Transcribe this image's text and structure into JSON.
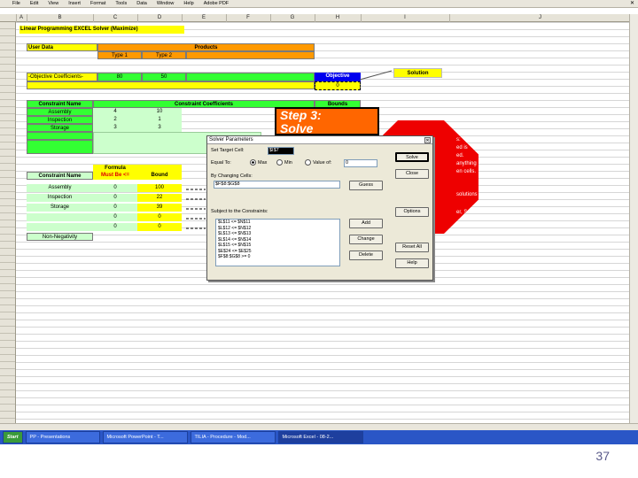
{
  "app": {
    "menu": [
      "File",
      "Edit",
      "View",
      "Insert",
      "Format",
      "Tools",
      "Data",
      "Window",
      "Help",
      "Adobe PDF"
    ],
    "columns": [
      "A",
      "B",
      "C",
      "D",
      "E",
      "F",
      "G",
      "H",
      "I",
      "J"
    ]
  },
  "sheet": {
    "title": "Linear Programming EXCEL Solver (Maximize)",
    "user_data": "User Data",
    "products": "Products",
    "type1": "Type 1",
    "type2": "Type 2",
    "objective_coefficients": "-Objective Coefficients-",
    "coef1": "80",
    "coef2": "50",
    "objective": "Objective",
    "objective_value": "0",
    "solution_label": "Solution",
    "constraint_name_header": "Constraint Name",
    "constraint_coefficients_header": "Constraint Coefficients",
    "bounds_header": "Bounds",
    "constraints": [
      {
        "name": "Assembly",
        "c1": "4",
        "c2": "10"
      },
      {
        "name": "Inspection",
        "c1": "2",
        "c2": "1"
      },
      {
        "name": "Storage",
        "c1": "3",
        "c2": "3"
      }
    ],
    "formula_header_1": "Formula",
    "formula_header_2": "Must Be <=",
    "bound_header": "Bound",
    "formula_rows": [
      {
        "name": "Assembly",
        "formula": "0",
        "bound": "100"
      },
      {
        "name": "Inspection",
        "formula": "0",
        "bound": "22"
      },
      {
        "name": "Storage",
        "formula": "0",
        "bound": "39"
      },
      {
        "name": "",
        "formula": "0",
        "bound": "0"
      },
      {
        "name": "",
        "formula": "0",
        "bound": "0"
      }
    ],
    "non_negativity": "Non-Negativity"
  },
  "step": {
    "line1": "Step 3:",
    "line2": "Solve"
  },
  "octagon_lines": [
    "s:",
    "ed is",
    "ed.",
    "anything",
    "en cells.",
    "",
    "solutions",
    "",
    "er, Solve."
  ],
  "dialog": {
    "title": "Solver Parameters",
    "set_target_label": "Set Target Cell:",
    "target_value": "$I$7",
    "equal_to_label": "Equal To:",
    "max_label": "Max",
    "min_label": "Min",
    "value_of_label": "Value of:",
    "value_of_value": "0",
    "by_changing_label": "By Changing Cells:",
    "changing_value": "$F$8:$G$8",
    "guess_label": "Guess",
    "subject_label": "Subject to the Constraints:",
    "constraints": [
      "$L$11 <= $N$11",
      "$L$12 <= $N$12",
      "$L$13 <= $N$13",
      "$L$14 <= $N$14",
      "$L$15 <= $N$15",
      "$E$24 <= $E$25",
      "$F$8:$G$8 >= 0"
    ],
    "add_label": "Add",
    "change_label": "Change",
    "delete_label": "Delete",
    "solve_label": "Solve",
    "close_label": "Close",
    "options_label": "Options",
    "reset_label": "Reset All",
    "help_label": "Help"
  },
  "taskbar": {
    "start": "Start",
    "tasks": [
      "PP - Presentations",
      "Microsoft PowerPoint - T...",
      "TILIA - Procedure - Mod...",
      "Microsoft Excel - 08-2..."
    ],
    "clock": ""
  },
  "page_number": "37"
}
